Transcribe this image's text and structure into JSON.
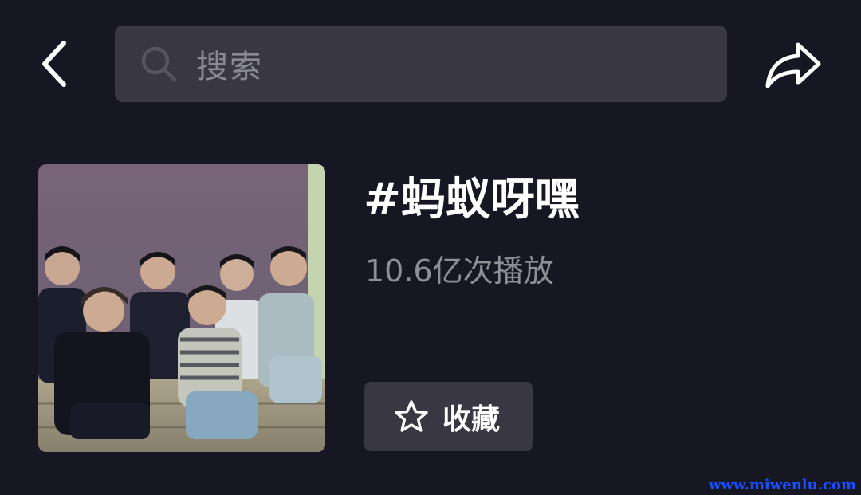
{
  "header": {
    "back_icon": "chevron-left-icon",
    "search": {
      "icon": "search-icon",
      "placeholder": "搜索"
    },
    "share_icon": "share-arrow-icon"
  },
  "topic": {
    "title": "#蚂蚁呀嘿",
    "plays": "10.6亿次播放",
    "favorite": {
      "icon": "star-outline-icon",
      "label": "收藏"
    }
  },
  "watermark": "www.miwenlu.com",
  "colors": {
    "background": "#161722",
    "search_bar": "#393842",
    "button": "#393842",
    "secondary_text": "#8f8f98",
    "watermark": "#1a4fff"
  }
}
